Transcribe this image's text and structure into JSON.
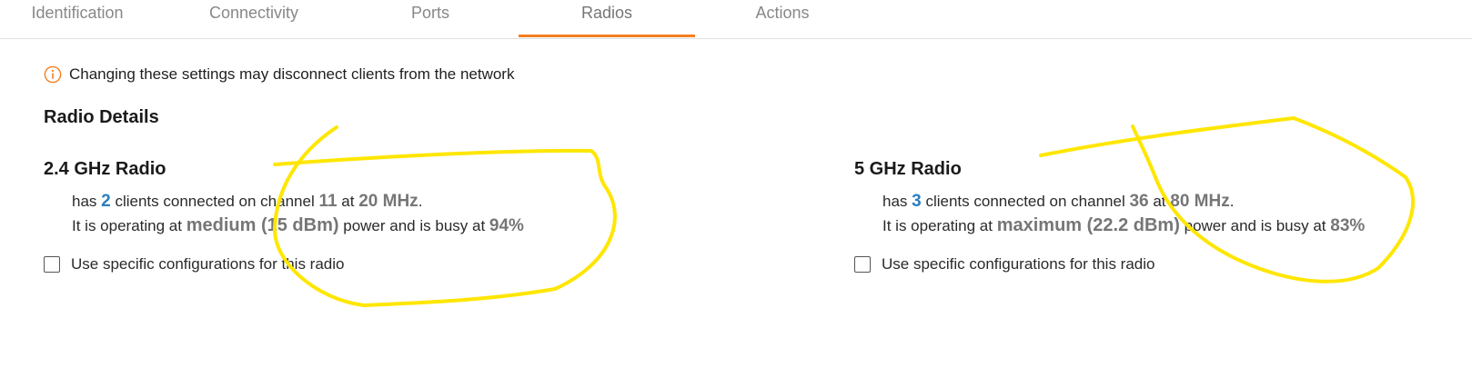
{
  "tabs": [
    {
      "label": "Identification"
    },
    {
      "label": "Connectivity"
    },
    {
      "label": "Ports"
    },
    {
      "label": "Radios"
    },
    {
      "label": "Actions"
    }
  ],
  "active_tab": "Radios",
  "accent_color": "#f57f20",
  "warning": {
    "icon": "info-icon",
    "text": "Changing these settings may disconnect clients from the network"
  },
  "section_title": "Radio Details",
  "radio_24": {
    "title": "2.4 GHz Radio",
    "w_has": "has",
    "clients": "2",
    "w_clients_on_channel": "clients connected on channel",
    "channel": "11",
    "w_at": "at",
    "width": "20 MHz",
    "w_period": ".",
    "w_operating": "It is operating at",
    "power": "medium (15 dBm)",
    "w_busy": "power and is busy at",
    "busy": "94%",
    "checkbox_label": "Use specific configurations for this radio",
    "checkbox_checked": false
  },
  "radio_5": {
    "title": "5 GHz Radio",
    "w_has": "has",
    "clients": "3",
    "w_clients_on_channel": "clients connected on channel",
    "channel": "36",
    "w_at": "at",
    "width": "80 MHz",
    "w_period": ".",
    "w_operating": "It is operating at",
    "power": "maximum (22.2 dBm)",
    "w_busy": "power and is busy at",
    "busy": "83%",
    "checkbox_label": "Use specific configurations for this radio",
    "checkbox_checked": false
  },
  "annotation_color": "#ffe600"
}
